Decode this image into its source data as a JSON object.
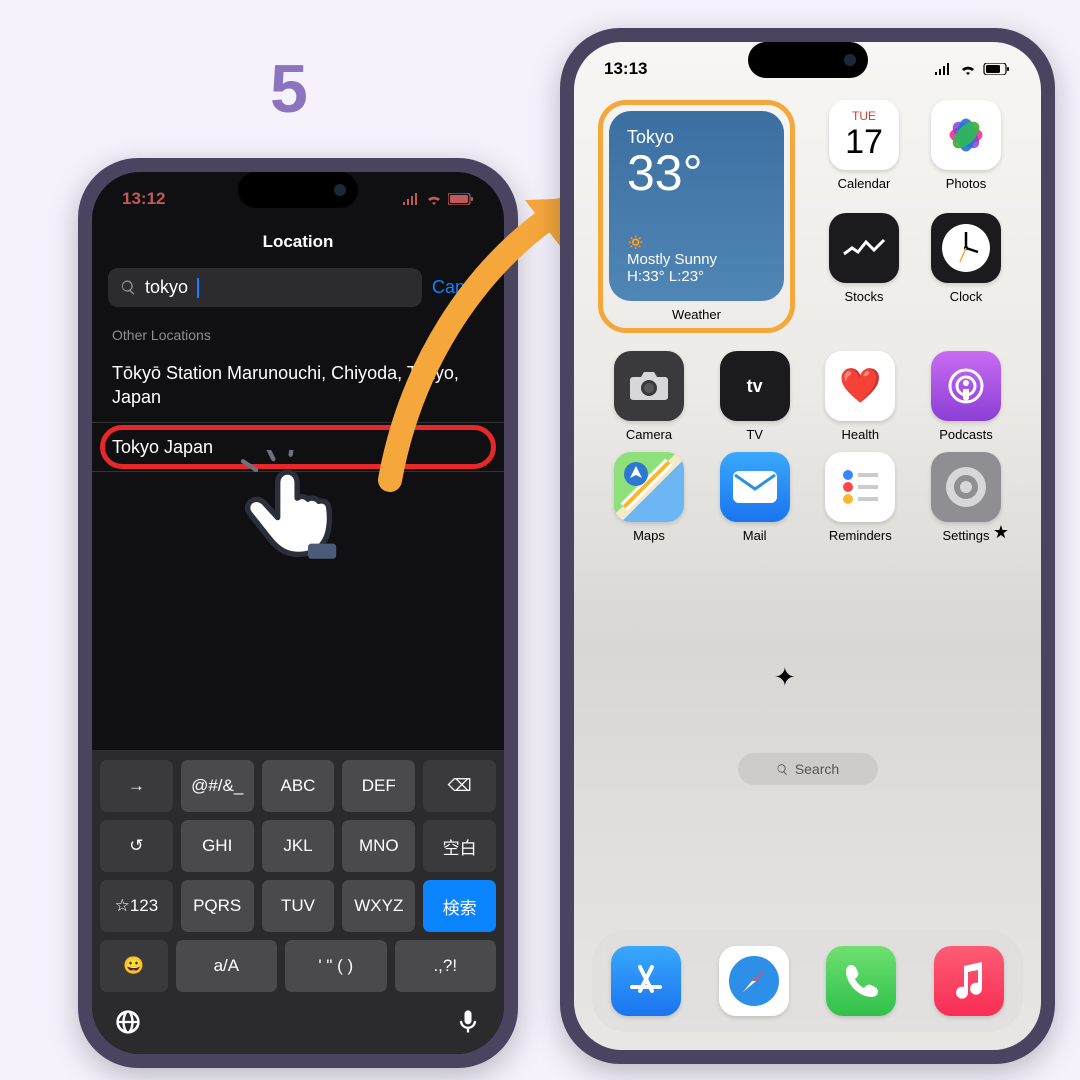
{
  "step": "5",
  "left": {
    "time": "13:12",
    "title": "Location",
    "search": "tokyo",
    "cancel": "Cancel",
    "section": "Other Locations",
    "results": [
      "Tōkyō Station Marunouchi, Chiyoda, Tokyo, Japan",
      "Tokyo Japan"
    ],
    "keys": {
      "r1": [
        "→",
        "@#/&_",
        "ABC",
        "DEF",
        "⌫"
      ],
      "r2": [
        "↺",
        "GHI",
        "JKL",
        "MNO",
        "空白"
      ],
      "r3": [
        "☆123",
        "PQRS",
        "TUV",
        "WXYZ",
        "検索"
      ],
      "r4": [
        "😀",
        "a/A",
        "' \" ( )",
        ".,?!"
      ]
    }
  },
  "right": {
    "time": "13:13",
    "widget": {
      "city": "Tokyo",
      "temp": "33°",
      "icon": "☀",
      "cond": "Mostly Sunny",
      "range": "H:33° L:23°",
      "label": "Weather"
    },
    "apps": {
      "calendar_day": "TUE",
      "calendar_date": "17",
      "calendar": "Calendar",
      "photos": "Photos",
      "stocks": "Stocks",
      "clock": "Clock",
      "camera": "Camera",
      "tv": "TV",
      "health": "Health",
      "podcasts": "Podcasts",
      "maps": "Maps",
      "mail": "Mail",
      "reminders": "Reminders",
      "settings": "Settings"
    },
    "search": "Search"
  }
}
